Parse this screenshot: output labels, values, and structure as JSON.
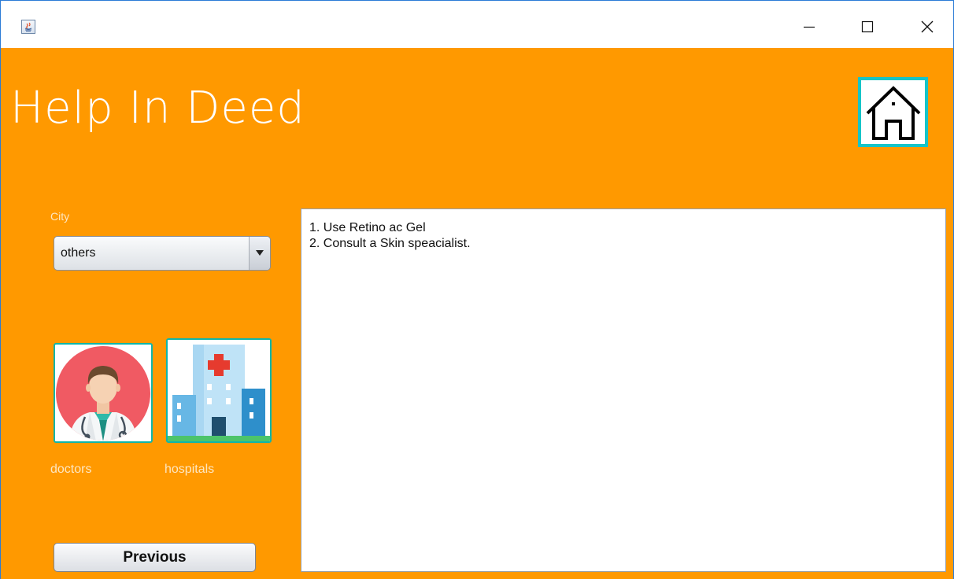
{
  "window": {
    "controls": {
      "minimize_icon": "minimize-icon",
      "maximize_icon": "maximize-icon",
      "close_icon": "close-icon"
    }
  },
  "app": {
    "title": "Help In Deed",
    "accent_color": "#ff9900",
    "highlight_color": "#16c4c8"
  },
  "city": {
    "label": "City",
    "selected": "others"
  },
  "services": [
    {
      "label": "doctors",
      "icon": "doctor-icon"
    },
    {
      "label": "hospitals",
      "icon": "hospital-icon"
    }
  ],
  "advice": {
    "lines": [
      "1. Use Retino ac Gel",
      "2. Consult a Skin speacialist."
    ]
  },
  "navigation": {
    "previous_label": "Previous",
    "home_icon": "home-icon"
  }
}
